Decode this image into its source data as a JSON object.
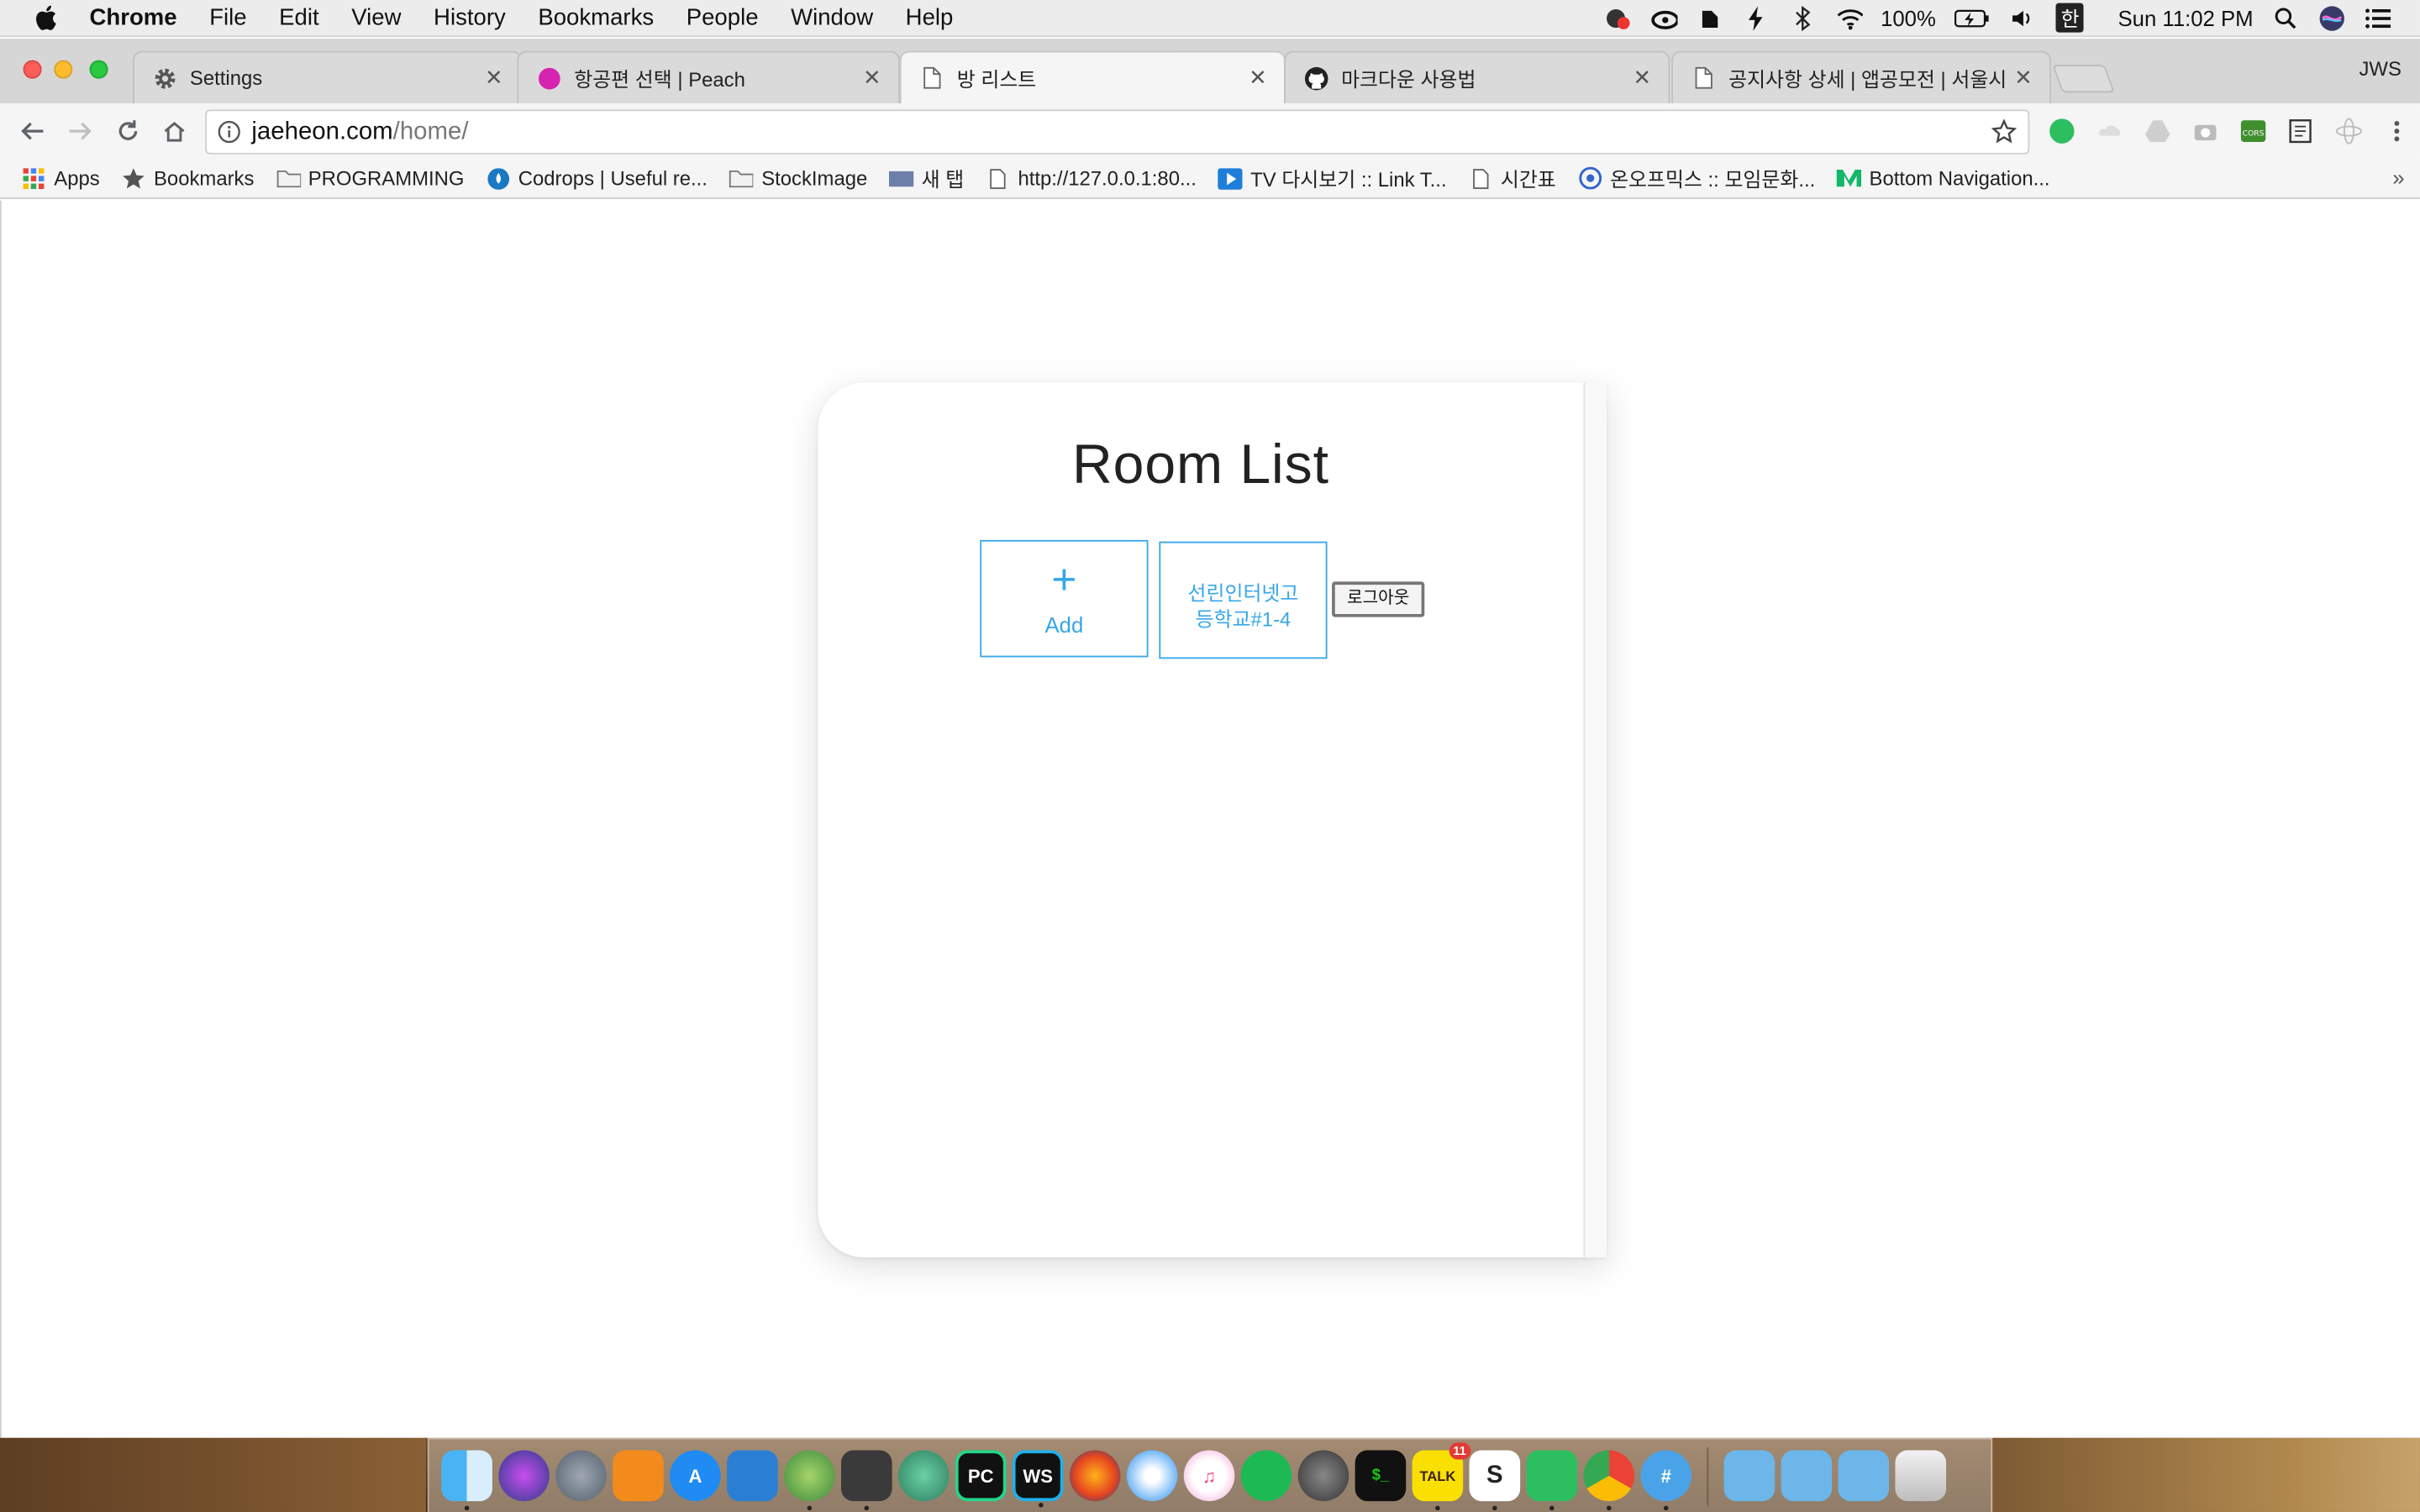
{
  "menubar": {
    "app_name": "Chrome",
    "items": [
      "File",
      "Edit",
      "View",
      "History",
      "Bookmarks",
      "People",
      "Window",
      "Help"
    ],
    "battery": "100%",
    "input_method": "한",
    "clock": "Sun 11:02 PM"
  },
  "tabs": [
    {
      "title": "Settings",
      "icon": "gear-icon"
    },
    {
      "title": "항공편 선택 | Peach",
      "icon": "peach-icon"
    },
    {
      "title": "방 리스트",
      "icon": "page-icon"
    },
    {
      "title": "마크다운 사용법",
      "icon": "github-icon"
    },
    {
      "title": "공지사항 상세 | 앱공모전 | 서울시 도",
      "icon": "page-icon"
    }
  ],
  "profile_name": "JWS",
  "address": {
    "host": "jaeheon.com",
    "path": "/home/"
  },
  "bookmarks": [
    {
      "label": "Apps",
      "icon": "apps-grid-icon"
    },
    {
      "label": "Bookmarks",
      "icon": "star-icon"
    },
    {
      "label": "PROGRAMMING",
      "icon": "folder-icon"
    },
    {
      "label": "Codrops | Useful re...",
      "icon": "codrops-icon"
    },
    {
      "label": "StockImage",
      "icon": "folder-icon"
    },
    {
      "label": "새 탭",
      "icon": "newtab-icon"
    },
    {
      "label": "http://127.0.0.1:80...",
      "icon": "page-icon"
    },
    {
      "label": "TV 다시보기 :: Link T...",
      "icon": "play-icon"
    },
    {
      "label": "시간표",
      "icon": "page-icon"
    },
    {
      "label": "온오프믹스 :: 모임문화...",
      "icon": "onoffmix-icon"
    },
    {
      "label": "Bottom Navigation...",
      "icon": "medium-icon"
    }
  ],
  "page": {
    "title": "Room List",
    "add_symbol": "+",
    "add_label": "Add",
    "room_name": "선린인터넷고등학교#1-4",
    "logout_label": "로그아웃"
  },
  "dock": {
    "kakaotalk_badge": "11",
    "kakaotalk_label": "TALK"
  }
}
